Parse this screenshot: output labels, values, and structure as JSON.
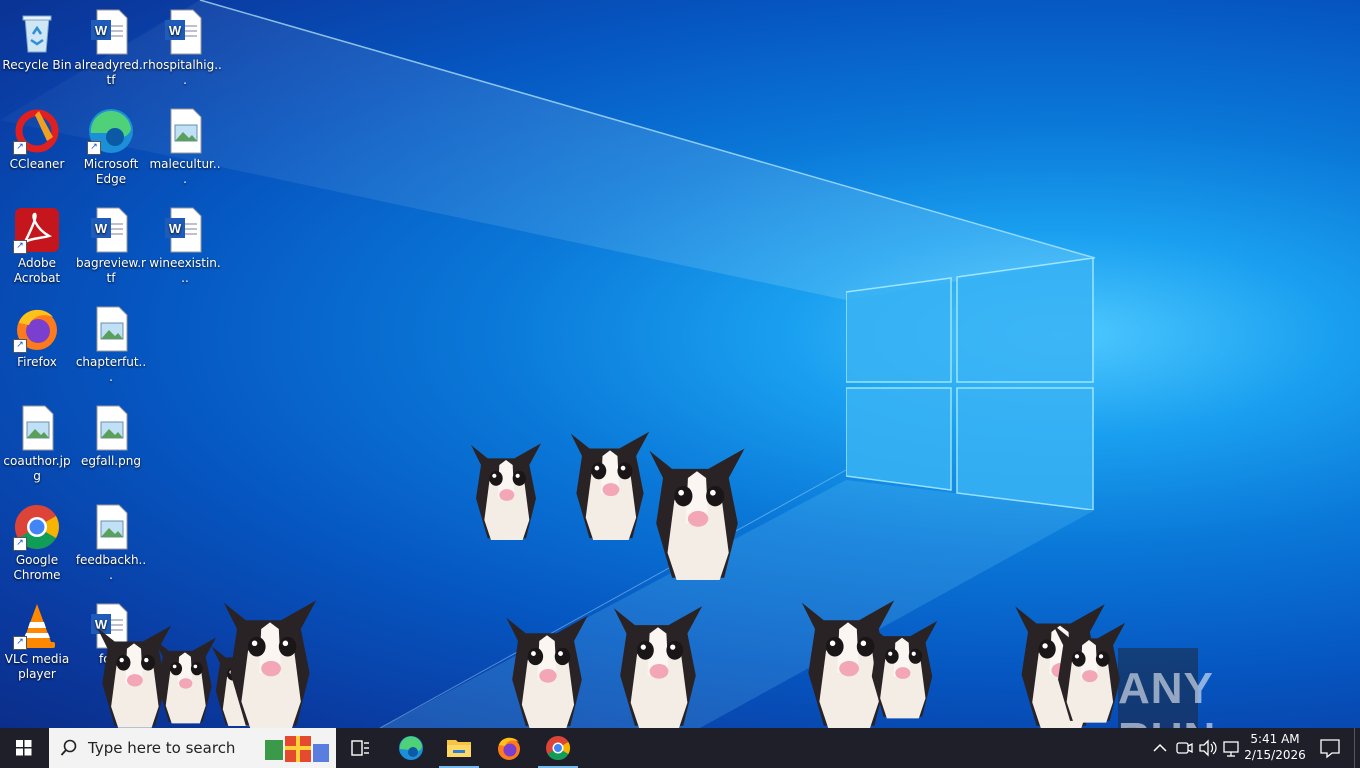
{
  "desktop": {
    "icons": [
      {
        "label": "Recycle Bin",
        "icon": "recycle-bin-icon"
      },
      {
        "label": "alreadyred.rtf",
        "icon": "word-doc-icon"
      },
      {
        "label": "hospitalhig...",
        "icon": "word-doc-icon"
      },
      {
        "label": "CCleaner",
        "icon": "ccleaner-icon"
      },
      {
        "label": "Microsoft Edge",
        "icon": "edge-icon"
      },
      {
        "label": "malecultur...",
        "icon": "image-file-icon"
      },
      {
        "label": "Adobe Acrobat",
        "icon": "acrobat-icon"
      },
      {
        "label": "bagreview.rtf",
        "icon": "word-doc-icon"
      },
      {
        "label": "wineexistin...",
        "icon": "word-doc-icon"
      },
      {
        "label": "Firefox",
        "icon": "firefox-icon"
      },
      {
        "label": "chapterfut...",
        "icon": "image-file-icon"
      },
      {
        "label": "coauthor.jpg",
        "icon": "image-file-icon"
      },
      {
        "label": "egfall.png",
        "icon": "image-file-icon"
      },
      {
        "label": "Google Chrome",
        "icon": "chrome-icon"
      },
      {
        "label": "feedbackh...",
        "icon": "image-file-icon"
      },
      {
        "label": "VLC media player",
        "icon": "vlc-icon"
      },
      {
        "label": "ford",
        "icon": "word-doc-icon"
      }
    ]
  },
  "taskbar": {
    "search_placeholder": "Type here to search",
    "pinned": [
      "task-view-icon",
      "edge-icon",
      "file-explorer-icon",
      "firefox-icon",
      "chrome-icon"
    ],
    "clock_time": "5:41 AM",
    "clock_date": "2/15/2026"
  },
  "watermark": {
    "text": "ANY RUN"
  },
  "colors": {
    "taskbar": "#1f1f2a",
    "search_bg": "#f3f3f3",
    "accent": "#76b9ed"
  }
}
